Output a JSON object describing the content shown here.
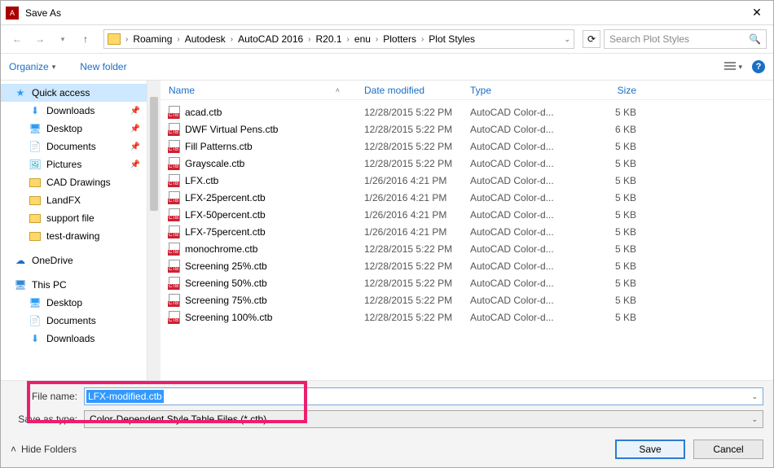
{
  "window": {
    "title": "Save As"
  },
  "breadcrumbs": {
    "items": [
      "Roaming",
      "Autodesk",
      "AutoCAD 2016",
      "R20.1",
      "enu",
      "Plotters",
      "Plot Styles"
    ]
  },
  "search": {
    "placeholder": "Search Plot Styles"
  },
  "toolbar": {
    "organize": "Organize",
    "new_folder": "New folder"
  },
  "sidebar": {
    "quick_access": "Quick access",
    "downloads": "Downloads",
    "desktop": "Desktop",
    "documents": "Documents",
    "pictures": "Pictures",
    "cad": "CAD Drawings",
    "landfx": "LandFX",
    "support": "support file",
    "testdraw": "test-drawing",
    "onedrive": "OneDrive",
    "thispc": "This PC",
    "desktop2": "Desktop",
    "documents2": "Documents",
    "downloads2": "Downloads"
  },
  "columns": {
    "name": "Name",
    "date": "Date modified",
    "type": "Type",
    "size": "Size"
  },
  "files": [
    {
      "name": "acad.ctb",
      "date": "12/28/2015 5:22 PM",
      "type": "AutoCAD Color-d...",
      "size": "5 KB"
    },
    {
      "name": "DWF Virtual Pens.ctb",
      "date": "12/28/2015 5:22 PM",
      "type": "AutoCAD Color-d...",
      "size": "6 KB"
    },
    {
      "name": "Fill Patterns.ctb",
      "date": "12/28/2015 5:22 PM",
      "type": "AutoCAD Color-d...",
      "size": "5 KB"
    },
    {
      "name": "Grayscale.ctb",
      "date": "12/28/2015 5:22 PM",
      "type": "AutoCAD Color-d...",
      "size": "5 KB"
    },
    {
      "name": "LFX.ctb",
      "date": "1/26/2016 4:21 PM",
      "type": "AutoCAD Color-d...",
      "size": "5 KB"
    },
    {
      "name": "LFX-25percent.ctb",
      "date": "1/26/2016 4:21 PM",
      "type": "AutoCAD Color-d...",
      "size": "5 KB"
    },
    {
      "name": "LFX-50percent.ctb",
      "date": "1/26/2016 4:21 PM",
      "type": "AutoCAD Color-d...",
      "size": "5 KB"
    },
    {
      "name": "LFX-75percent.ctb",
      "date": "1/26/2016 4:21 PM",
      "type": "AutoCAD Color-d...",
      "size": "5 KB"
    },
    {
      "name": "monochrome.ctb",
      "date": "12/28/2015 5:22 PM",
      "type": "AutoCAD Color-d...",
      "size": "5 KB"
    },
    {
      "name": "Screening 25%.ctb",
      "date": "12/28/2015 5:22 PM",
      "type": "AutoCAD Color-d...",
      "size": "5 KB"
    },
    {
      "name": "Screening 50%.ctb",
      "date": "12/28/2015 5:22 PM",
      "type": "AutoCAD Color-d...",
      "size": "5 KB"
    },
    {
      "name": "Screening 75%.ctb",
      "date": "12/28/2015 5:22 PM",
      "type": "AutoCAD Color-d...",
      "size": "5 KB"
    },
    {
      "name": "Screening 100%.ctb",
      "date": "12/28/2015 5:22 PM",
      "type": "AutoCAD Color-d...",
      "size": "5 KB"
    }
  ],
  "footer": {
    "filename_label": "File name:",
    "filename_value": "LFX-modified.ctb",
    "type_label": "Save as type:",
    "type_value": "Color-Dependent Style Table Files (*.ctb)",
    "hide_folders": "Hide Folders",
    "save": "Save",
    "cancel": "Cancel"
  }
}
